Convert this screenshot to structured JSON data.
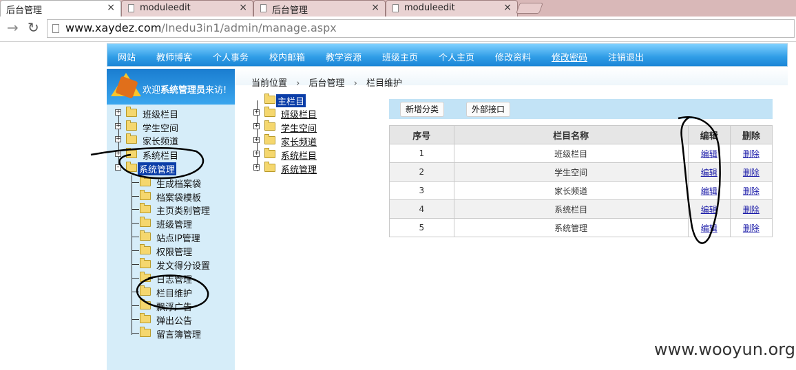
{
  "browser": {
    "tabs": [
      {
        "title": "后台管理",
        "active": true
      },
      {
        "title": "moduleedit",
        "active": false
      },
      {
        "title": "后台管理",
        "active": false
      },
      {
        "title": "moduleedit",
        "active": false
      }
    ],
    "close_glyph": "×",
    "url_host": "www.xaydez.com",
    "url_path": "/Inedu3in1/admin/manage.aspx"
  },
  "site_nav": {
    "items": [
      "网站",
      "教师博客",
      "个人事务",
      "校内邮箱",
      "教学资源",
      "班级主页",
      "个人主页",
      "修改资料",
      "修改密码",
      "注销退出"
    ],
    "colors": {
      "bar": "#2f9ce6",
      "text": "#ffffff"
    }
  },
  "left_panel": {
    "welcome_prefix": "欢迎",
    "welcome_user": "系统管理员",
    "welcome_suffix": "来访!",
    "tree": [
      {
        "label": "班级栏目",
        "expander": "+"
      },
      {
        "label": "学生空间",
        "expander": "+"
      },
      {
        "label": "家长频道",
        "expander": "+"
      },
      {
        "label": "系统栏目",
        "expander": "+"
      },
      {
        "label": "系统管理",
        "expander": "-",
        "selected": true
      }
    ],
    "children": [
      "生成档案袋",
      "档案袋模板",
      "主页类别管理",
      "班级管理",
      "站点IP管理",
      "权限管理",
      "发文得分设置",
      "日志管理",
      "栏目维护",
      "飘浮广告",
      "弹出公告",
      "留言簿管理"
    ]
  },
  "breadcrumb": {
    "items": [
      "当前位置",
      "后台管理",
      "栏目维护"
    ],
    "separator": "›"
  },
  "column_tree": {
    "root": "主栏目",
    "children": [
      "班级栏目",
      "学生空间",
      "家长频道",
      "系统栏目",
      "系统管理"
    ]
  },
  "toolbar": {
    "add_category": "新增分类",
    "external_api": "外部接口"
  },
  "table": {
    "headers": [
      "序号",
      "栏目名称",
      "编辑",
      "删除"
    ],
    "rows": [
      {
        "no": "1",
        "name": "班级栏目",
        "edit": "编辑",
        "delete": "删除"
      },
      {
        "no": "2",
        "name": "学生空间",
        "edit": "编辑",
        "delete": "删除"
      },
      {
        "no": "3",
        "name": "家长频道",
        "edit": "编辑",
        "delete": "删除"
      },
      {
        "no": "4",
        "name": "系统栏目",
        "edit": "编辑",
        "delete": "删除"
      },
      {
        "no": "5",
        "name": "系统管理",
        "edit": "编辑",
        "delete": "删除"
      }
    ]
  },
  "watermark": "www.wooyun.org"
}
